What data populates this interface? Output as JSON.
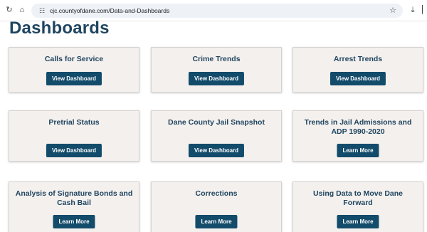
{
  "browser": {
    "url": "cjc.countyofdane.com/Data-and-Dashboards"
  },
  "page": {
    "title": "Dashboards"
  },
  "cards": [
    {
      "title": "Calls for Service",
      "button": "View Dashboard"
    },
    {
      "title": "Crime Trends",
      "button": "View Dashboard"
    },
    {
      "title": "Arrest Trends",
      "button": "View Dashboard"
    },
    {
      "title": "Pretrial Status",
      "button": "View Dashboard"
    },
    {
      "title": "Dane County Jail Snapshot",
      "button": "View Dashboard"
    },
    {
      "title": "Trends in Jail Admissions and ADP 1990-2020",
      "button": "Learn More"
    },
    {
      "title": "Analysis of Signature Bonds and Cash Bail",
      "button": "Learn More"
    },
    {
      "title": "Corrections",
      "button": "Learn More"
    },
    {
      "title": "Using Data to Move Dane Forward",
      "button": "Learn More"
    }
  ],
  "colors": {
    "title": "#1f4560",
    "button": "#134b6b",
    "card_bg": "#f4f0ed"
  }
}
